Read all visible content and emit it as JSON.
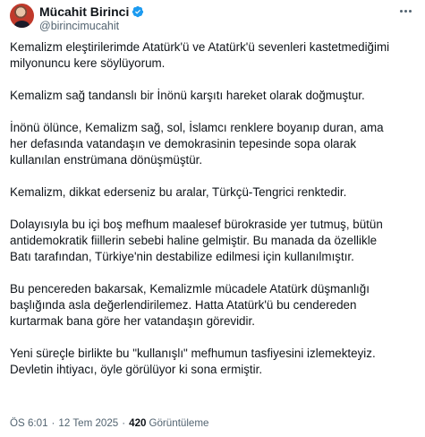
{
  "author": {
    "display_name": "Mücahit Birinci",
    "handle": "@birincimucahit",
    "verified": true
  },
  "colors": {
    "verified_badge": "#1d9bf0",
    "text_primary": "#0f1419",
    "text_secondary": "#536471"
  },
  "icons": {
    "verified": "verified-badge-icon",
    "more": "more-options-icon"
  },
  "tweet": {
    "paragraphs": [
      "Kemalizm eleştirilerimde Atatürk'ü ve Atatürk'ü sevenleri kastetmediğimi\nmilyonuncu kere söylüyorum.",
      "Kemalizm sağ tandanslı bir İnönü karşıtı hareket olarak doğmuştur.",
      "İnönü ölünce, Kemalizm sağ, sol, İslamcı renklere boyanıp duran, ama\nher defasında vatandaşın ve demokrasinin tepesinde sopa olarak\nkullanılan enstrümana dönüşmüştür.",
      "Kemalizm, dikkat ederseniz bu aralar, Türkçü-Tengrici renktedir.",
      "Dolayısıyla bu içi boş mefhum maalesef bürokraside yer tutmuş, bütün\nantidemokratik fiillerin sebebi haline gelmiştir. Bu manada da özellikle\nBatı tarafından, Türkiye'nin destabilize edilmesi için kullanılmıştır.",
      "Bu pencereden bakarsak, Kemalizmle mücadele Atatürk düşmanlığı\nbaşlığında asla değerlendirilemez. Hatta Atatürk'ü bu cendereden\nkurtarmak bana göre her vatandaşın görevidir.",
      "Yeni süreçle birlikte bu \"kullanışlı\" mefhumun tasfiyesini izlemekteyiz.\nDevletin ihtiyacı, öyle görülüyor ki sona ermiştir."
    ]
  },
  "meta": {
    "time": "ÖS 6:01",
    "separator": "·",
    "date": "12 Tem 2025",
    "views_count": "420",
    "views_label": "Görüntüleme"
  }
}
